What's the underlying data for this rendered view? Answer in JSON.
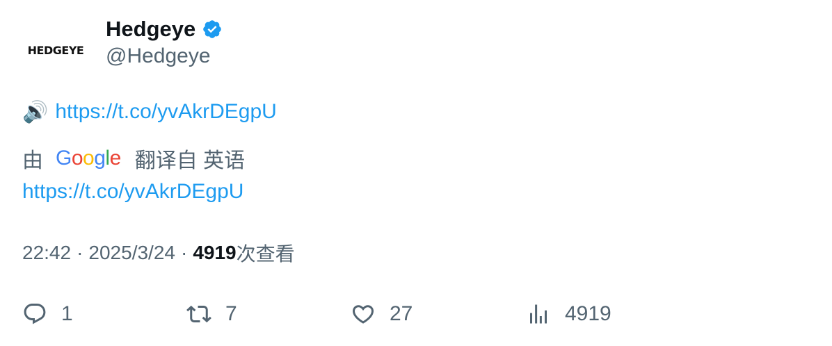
{
  "author": {
    "avatar_text": "HEDGEYE",
    "display_name": "Hedgeye",
    "handle": "@Hedgeye"
  },
  "tweet": {
    "speaker_icon": "🔊",
    "link_text": "https://t.co/yvAkrDEgpU",
    "translation": {
      "by": "由",
      "provider_letters": [
        "G",
        "o",
        "o",
        "g",
        "l",
        "e"
      ],
      "translated_from": "翻译自 英语",
      "link_text": "https://t.co/yvAkrDEgpU"
    }
  },
  "meta": {
    "time": "22:42",
    "separator": "·",
    "date": "2025/3/24",
    "views_count": "4919",
    "views_label": "次查看"
  },
  "actions": {
    "replies": "1",
    "retweets": "7",
    "likes": "27",
    "views": "4919"
  },
  "colors": {
    "link": "#1d9bf0",
    "muted": "#536471",
    "verified": "#1d9bf0"
  }
}
